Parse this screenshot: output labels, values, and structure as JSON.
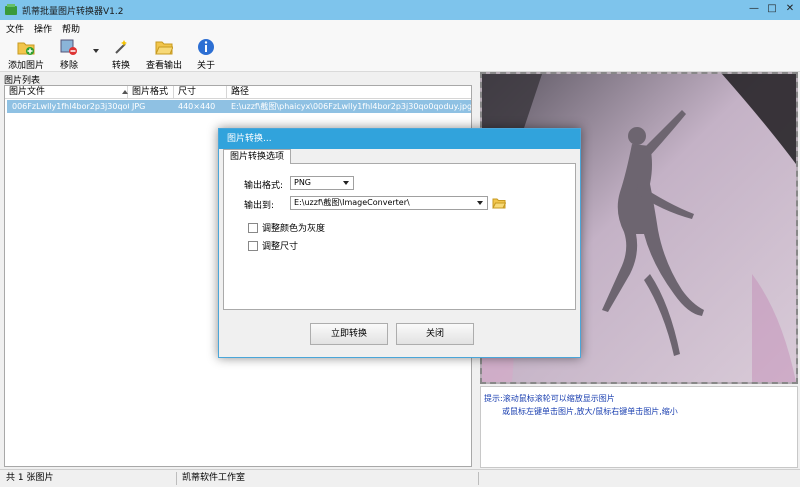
{
  "window": {
    "title": "凯蒂批量图片转换器V1.2"
  },
  "menu": [
    "文件",
    "操作",
    "帮助"
  ],
  "toolbar": {
    "add": "添加图片",
    "remove": "移除",
    "convert": "转换",
    "view_output": "查看输出",
    "about": "关于"
  },
  "list": {
    "label": "图片列表",
    "columns": [
      "图片文件",
      "图片格式",
      "尺寸",
      "路径"
    ],
    "rows": [
      {
        "file": "006FzLwlly1fhl4bor2p3j30qo0qodu",
        "format": "JPG",
        "size": "440×440",
        "path": "E:\\uzzf\\截图\\phaicyx\\006FzLwlly1fhl4bor2p3j30qo0qoduy.jpg"
      }
    ]
  },
  "preview": {
    "hint_line1": "提示:滚动鼠标滚轮可以缩放显示图片",
    "hint_line2": "或鼠标左键单击图片,放大/鼠标右键单击图片,缩小"
  },
  "status": {
    "count": "共 1 张图片",
    "studio": "凯蒂软件工作室"
  },
  "dialog": {
    "title": "图片转换...",
    "tab": "图片转换选项",
    "format_label": "输出格式:",
    "format_value": "PNG",
    "output_label": "输出到:",
    "output_value": "E:\\uzzf\\截图\\ImageConverter\\",
    "gray_label": "调整颜色为灰度",
    "resize_label": "调整尺寸",
    "convert_button": "立即转换",
    "close_button": "关闭"
  },
  "colors": {
    "titlebar": "#7ec4ec",
    "dialog_title": "#31a3dc",
    "selection": "#8fc1e3",
    "hint_text": "#1a3fb0"
  }
}
